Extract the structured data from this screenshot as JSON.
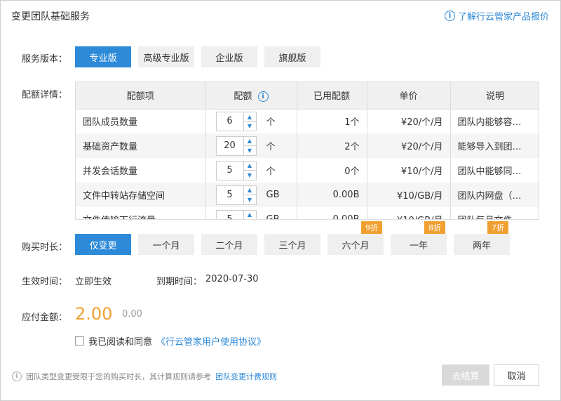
{
  "dialog": {
    "title": "变更团队基础服务",
    "help_link": "了解行云管家产品报价"
  },
  "version": {
    "label": "服务版本：",
    "options": [
      "专业版",
      "高级专业版",
      "企业版",
      "旗舰版"
    ],
    "selected": "专业版"
  },
  "quota": {
    "label": "配额详情：",
    "headers": [
      "配额项",
      "配额",
      "已用配额",
      "单价",
      "说明"
    ],
    "rows": [
      {
        "name": "团队成员数量",
        "qty": "6",
        "unit": "个",
        "used": "1个",
        "price": "¥20/个/月",
        "desc": "团队内能够容…"
      },
      {
        "name": "基础资产数量",
        "qty": "20",
        "unit": "个",
        "used": "2个",
        "price": "¥20/个/月",
        "desc": "能够导入到团…"
      },
      {
        "name": "并发会话数量",
        "qty": "5",
        "unit": "个",
        "used": "0个",
        "price": "¥10/个/月",
        "desc": "团队中能够同…"
      },
      {
        "name": "文件中转站存储空间",
        "qty": "5",
        "unit": "GB",
        "used": "0.00B",
        "price": "¥10/GB/月",
        "desc": "团队内网盘（…"
      },
      {
        "name": "文件传输下行流量",
        "qty": "5",
        "unit": "GB",
        "used": "0.00B",
        "price": "¥10/GB/月",
        "desc": "团队每月文件…"
      }
    ]
  },
  "duration": {
    "label": "购买时长：",
    "options": [
      {
        "label": "仅变更",
        "badge": ""
      },
      {
        "label": "一个月",
        "badge": ""
      },
      {
        "label": "二个月",
        "badge": ""
      },
      {
        "label": "三个月",
        "badge": ""
      },
      {
        "label": "六个月",
        "badge": "9折"
      },
      {
        "label": "一年",
        "badge": "8折"
      },
      {
        "label": "两年",
        "badge": "7折"
      }
    ],
    "selected": "仅变更"
  },
  "effective": {
    "label": "生效时间：",
    "value": "立即生效",
    "expire_label": "到期时间：",
    "expire_value": "2020-07-30"
  },
  "payment": {
    "label": "应付金额：",
    "amount": "2.00",
    "original": "0.00"
  },
  "agreement": {
    "text": "我已阅读和同意",
    "link": "《行云管家用户使用协议》"
  },
  "footer": {
    "note": "团队类型变更受限于您的购买时长，其计算规则请参考",
    "link": "团队变更计费规则",
    "pay_button": "去结算",
    "cancel_button": "取消"
  },
  "colors": {
    "accent": "#2d8ad8",
    "discount": "#f0a030"
  }
}
